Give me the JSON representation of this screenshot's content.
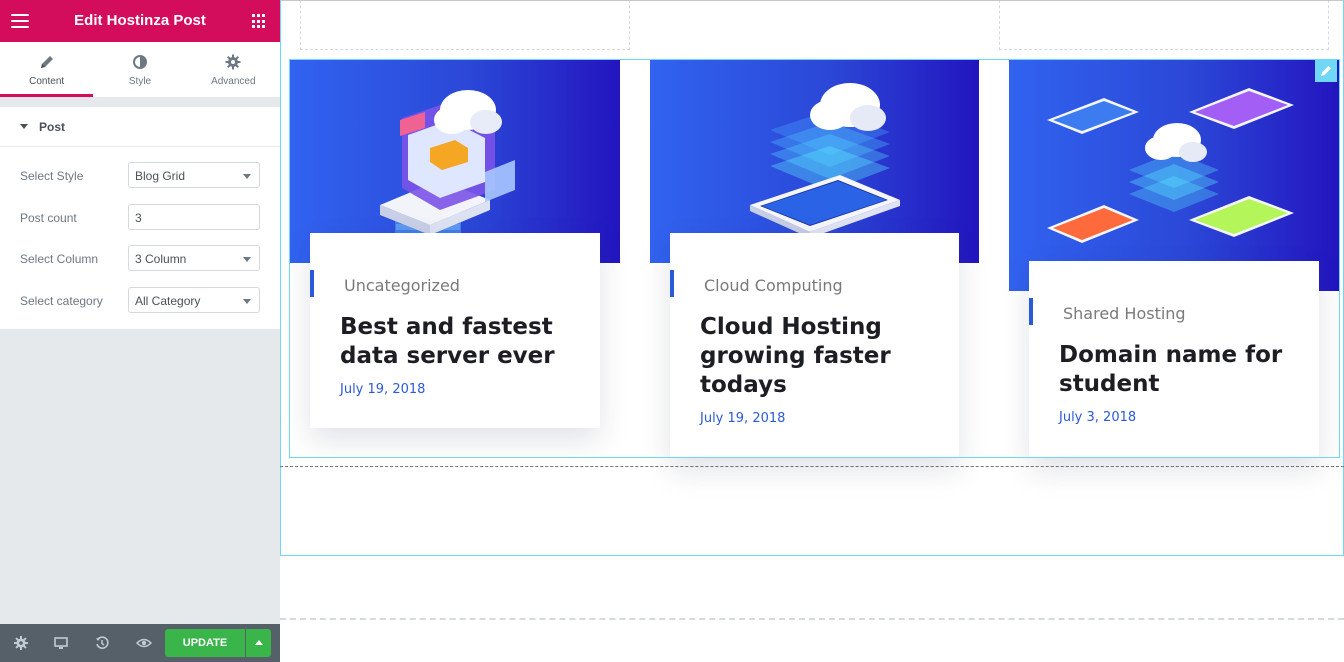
{
  "panel": {
    "title": "Edit Hostinza Post",
    "tabs": [
      {
        "label": "Content",
        "icon": "pencil-icon"
      },
      {
        "label": "Style",
        "icon": "half-circle-icon"
      },
      {
        "label": "Advanced",
        "icon": "gear-icon"
      }
    ],
    "section_title": "Post",
    "controls": [
      {
        "label": "Select Style",
        "value": "Blog Grid",
        "type": "select"
      },
      {
        "label": "Post count",
        "value": "3",
        "type": "number"
      },
      {
        "label": "Select Column",
        "value": "3 Column",
        "type": "select"
      },
      {
        "label": "Select category",
        "value": "All Category",
        "type": "select"
      }
    ],
    "footer": {
      "update_label": "UPDATE",
      "icons": [
        "settings-icon",
        "responsive-icon",
        "history-icon",
        "preview-icon"
      ]
    }
  },
  "posts": [
    {
      "category": "Uncategorized",
      "title": "Best and fastest data server ever",
      "date": "July 19, 2018"
    },
    {
      "category": "Cloud Computing",
      "title": "Cloud Hosting growing faster todays",
      "date": "July 19, 2018"
    },
    {
      "category": "Shared Hosting",
      "title": "Domain name for student",
      "date": "July 3, 2018"
    }
  ],
  "colors": {
    "brand": "#d30c5c",
    "accent": "#2b5ad9",
    "update": "#39b54a",
    "outline": "#71d7f7"
  }
}
